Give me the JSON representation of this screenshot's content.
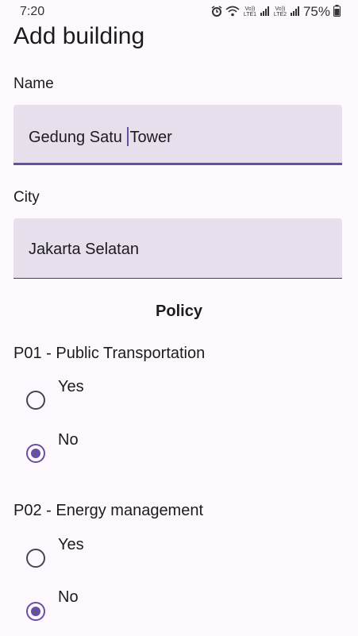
{
  "status_bar": {
    "time": "7:20",
    "sim1_label": "Vo)) LTE1",
    "sim2_label": "Vo)) LTE2",
    "battery": "75%",
    "icons": [
      "alarm-icon",
      "wifi-icon",
      "signal-icon",
      "battery-icon"
    ]
  },
  "page": {
    "title": "Add building"
  },
  "form": {
    "name": {
      "label": "Name",
      "value_before_cursor": "Gedung Satu ",
      "value_after_cursor": "Tower"
    },
    "city": {
      "label": "City",
      "value": "Jakarta Selatan"
    }
  },
  "policy": {
    "heading": "Policy",
    "questions": [
      {
        "title": "P01 - Public Transportation",
        "options": [
          "Yes",
          "No"
        ],
        "selected": "No"
      },
      {
        "title": "P02 - Energy management",
        "options": [
          "Yes",
          "No"
        ],
        "selected": "No"
      }
    ]
  },
  "colors": {
    "accent": "#6750a4",
    "field_bg": "#e7e0ec",
    "background": "#fdf8fd"
  }
}
